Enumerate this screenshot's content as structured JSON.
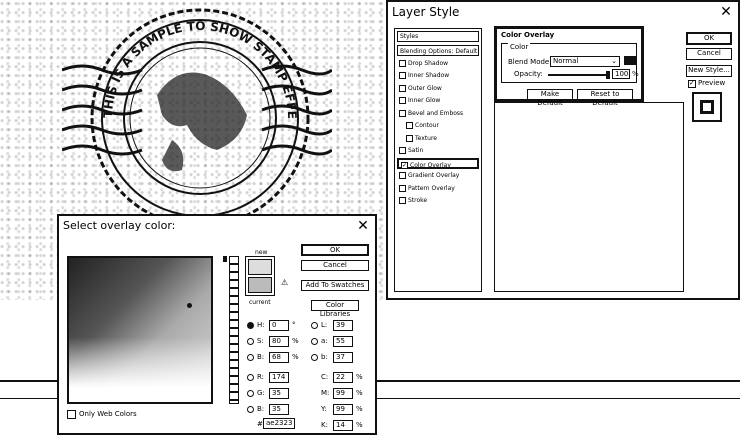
{
  "stamp": {
    "ring_text": "THIS IS A SAMPLE TO SHOW STAMP EFFECT"
  },
  "layer_style": {
    "title": "Layer Style",
    "sidebar": {
      "header": "Styles",
      "items": [
        {
          "label": "Blending Options: Default",
          "has_check": false,
          "indent": false,
          "active": false
        },
        {
          "label": "Drop Shadow",
          "has_check": true,
          "indent": false,
          "active": false
        },
        {
          "label": "Inner Shadow",
          "has_check": true,
          "indent": false,
          "active": false
        },
        {
          "label": "Outer Glow",
          "has_check": true,
          "indent": false,
          "active": false
        },
        {
          "label": "Inner Glow",
          "has_check": true,
          "indent": false,
          "active": false
        },
        {
          "label": "Bevel and Emboss",
          "has_check": true,
          "indent": false,
          "active": false
        },
        {
          "label": "Contour",
          "has_check": true,
          "indent": true,
          "active": false
        },
        {
          "label": "Texture",
          "has_check": true,
          "indent": true,
          "active": false
        },
        {
          "label": "Satin",
          "has_check": true,
          "indent": false,
          "active": false
        },
        {
          "label": "Color Overlay",
          "has_check": true,
          "indent": false,
          "active": true
        },
        {
          "label": "Gradient Overlay",
          "has_check": true,
          "indent": false,
          "active": false
        },
        {
          "label": "Pattern Overlay",
          "has_check": true,
          "indent": false,
          "active": false
        },
        {
          "label": "Stroke",
          "has_check": true,
          "indent": false,
          "active": false
        }
      ]
    },
    "overlay": {
      "group_title": "Color Overlay",
      "sub_title": "Color",
      "blend_mode_label": "Blend Mode:",
      "blend_mode_value": "Normal",
      "opacity_label": "Opacity:",
      "opacity_value": "100",
      "opacity_unit": "%",
      "make_default": "Make Default",
      "reset_default": "Reset to Default"
    },
    "buttons": {
      "ok": "OK",
      "cancel": "Cancel",
      "new_style": "New Style...",
      "preview": "Preview"
    }
  },
  "color_picker": {
    "title": "Select overlay color:",
    "ok": "OK",
    "cancel": "Cancel",
    "add_swatches": "Add To Swatches",
    "color_libraries": "Color Libraries",
    "new_label": "new",
    "current_label": "current",
    "only_web": "Only Web Colors",
    "fields": {
      "H": {
        "label": "H:",
        "value": "0",
        "unit": "°"
      },
      "S": {
        "label": "S:",
        "value": "80",
        "unit": "%"
      },
      "B": {
        "label": "B:",
        "value": "68",
        "unit": "%"
      },
      "R": {
        "label": "R:",
        "value": "174",
        "unit": ""
      },
      "G": {
        "label": "G:",
        "value": "35",
        "unit": ""
      },
      "Bl": {
        "label": "B:",
        "value": "35",
        "unit": ""
      },
      "L": {
        "label": "L:",
        "value": "39",
        "unit": ""
      },
      "a": {
        "label": "a:",
        "value": "55",
        "unit": ""
      },
      "b": {
        "label": "b:",
        "value": "37",
        "unit": ""
      },
      "C": {
        "label": "C:",
        "value": "22",
        "unit": "%"
      },
      "M": {
        "label": "M:",
        "value": "99",
        "unit": "%"
      },
      "Y": {
        "label": "Y:",
        "value": "99",
        "unit": "%"
      },
      "K": {
        "label": "K:",
        "value": "14",
        "unit": "%"
      }
    },
    "hex_label": "#",
    "hex_value": "ae2323"
  }
}
